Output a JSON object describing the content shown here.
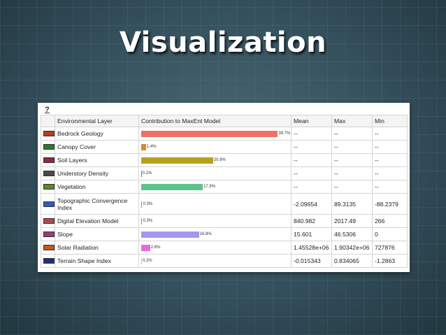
{
  "slide": {
    "title": "Visualization"
  },
  "help_label": "?",
  "columns": {
    "layer": "Environmental Layer",
    "contribution": "Contribution to MaxEnt Model",
    "mean": "Mean",
    "max": "Max",
    "min": "Min"
  },
  "rows": [
    {
      "swatch": "#b83c1f",
      "layer": "Bedrock Geology",
      "contribution": 39.7,
      "pct_label": "39.7%",
      "bar_color": "#ef7067",
      "mean": "--",
      "max": "--",
      "min": "--"
    },
    {
      "swatch": "#2f7a2b",
      "layer": "Canopy Cover",
      "contribution": 1.4,
      "pct_label": "1.4%",
      "bar_color": "#d48a28",
      "mean": "--",
      "max": "--",
      "min": "--"
    },
    {
      "swatch": "#8a2d3a",
      "layer": "Soil Layers",
      "contribution": 20.9,
      "pct_label": "20.9%",
      "bar_color": "#b5a21a",
      "mean": "--",
      "max": "--",
      "min": "--"
    },
    {
      "swatch": "#4a4a4a",
      "layer": "Understory Density",
      "contribution": 0.1,
      "pct_label": "0.1%",
      "bar_color": "#3aa63a",
      "mean": "--",
      "max": "--",
      "min": "--"
    },
    {
      "swatch": "#5a8a2a",
      "layer": "Vegetation",
      "contribution": 17.9,
      "pct_label": "17.9%",
      "bar_color": "#5cc48a",
      "mean": "--",
      "max": "--",
      "min": "--"
    },
    {
      "swatch": "#2d5fb8",
      "layer": "Topographic Convergence Index",
      "contribution": 0.3,
      "pct_label": "0.3%",
      "bar_color": "#4aa0d8",
      "mean": "-2.09654",
      "max": "89.3135",
      "min": "-88.2379"
    },
    {
      "swatch": "#b04a4a",
      "layer": "Digital Elevation Model",
      "contribution": 0.3,
      "pct_label": "0.3%",
      "bar_color": "#6a8fe0",
      "mean": "840.982",
      "max": "2017.49",
      "min": "266"
    },
    {
      "swatch": "#9a3b7a",
      "layer": "Slope",
      "contribution": 16.8,
      "pct_label": "16.8%",
      "bar_color": "#a696f0",
      "mean": "15.601",
      "max": "46.5306",
      "min": "0"
    },
    {
      "swatch": "#c8571a",
      "layer": "Solar Radiation",
      "contribution": 2.6,
      "pct_label": "2.6%",
      "bar_color": "#e86ae0",
      "mean": "1.45528e+06",
      "max": "1.90342e+06",
      "min": "727876"
    },
    {
      "swatch": "#1c2f7a",
      "layer": "Terrain Shape Index",
      "contribution": 0.2,
      "pct_label": "0.2%",
      "bar_color": "#c0c0c0",
      "mean": "-0.015343",
      "max": "0.834065",
      "min": "-1.2863"
    }
  ]
}
